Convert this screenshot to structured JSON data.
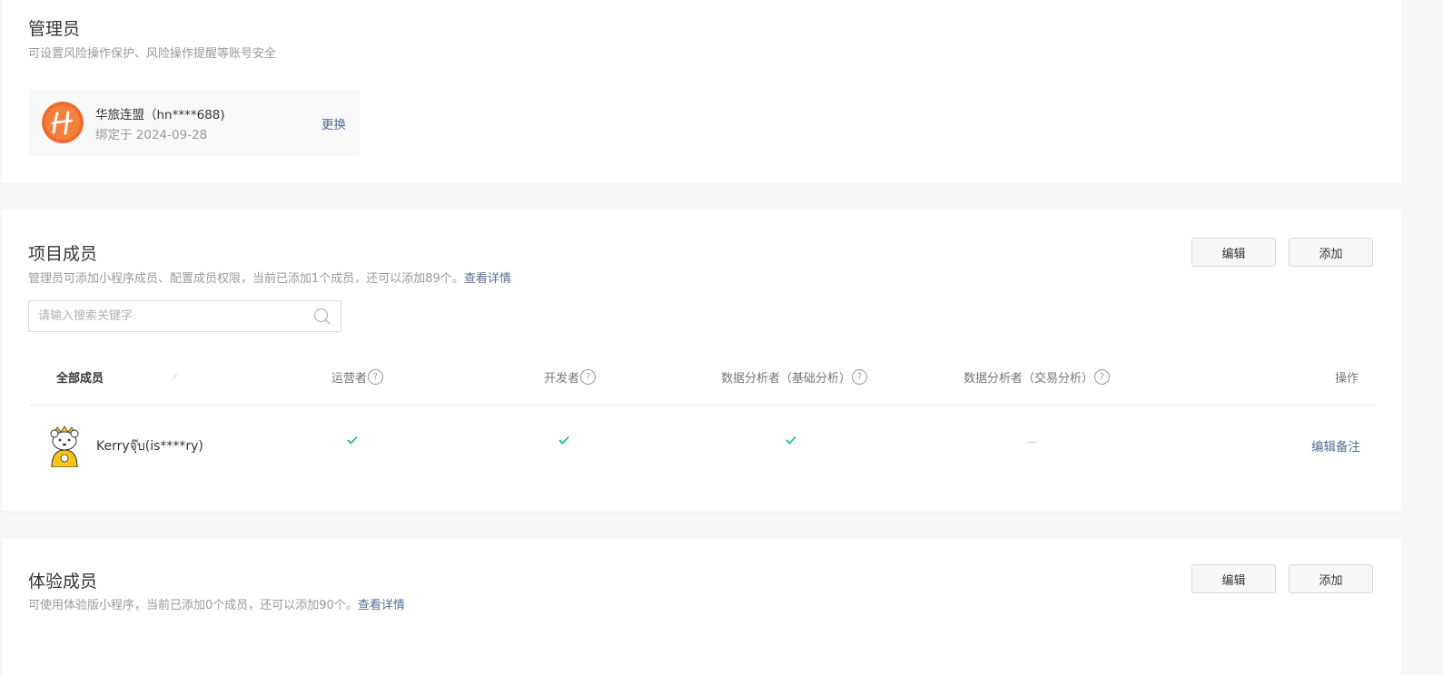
{
  "admin": {
    "title": "管理员",
    "description": "可设置风险操作保护、风险操作提醒等账号安全",
    "account_name": "华旅连盟（hn****688)",
    "bound_date": "绑定于 2024-09-28",
    "change_label": "更换",
    "avatar_icon": "orange-logo-avatar",
    "avatar_color": "#f16a2d"
  },
  "project_members": {
    "title": "项目成员",
    "description": "管理员可添加小程序成员、配置成员权限，当前已添加1个成员，还可以添加89个。",
    "details_link": "查看详情",
    "edit_label": "编辑",
    "add_label": "添加",
    "search_placeholder": "请输入搜索关键字",
    "columns": {
      "all_members": "全部成员",
      "operator": "运营者",
      "developer": "开发者",
      "analyst_basic": "数据分析者（基础分析）",
      "analyst_trade": "数据分析者（交易分析）",
      "actions": "操作"
    },
    "rows": [
      {
        "name": "Kerryจุ๊บ(is****ry)",
        "operator": true,
        "developer": true,
        "analyst_basic": true,
        "analyst_trade": false,
        "action_label": "编辑备注"
      }
    ]
  },
  "experience_members": {
    "title": "体验成员",
    "description": "可使用体验版小程序，当前已添加0个成员，还可以添加90个。",
    "details_link": "查看详情",
    "edit_label": "编辑",
    "add_label": "添加"
  },
  "colors": {
    "link": "#576b95",
    "check": "#07c160",
    "page_bg": "#f6f7f9"
  }
}
